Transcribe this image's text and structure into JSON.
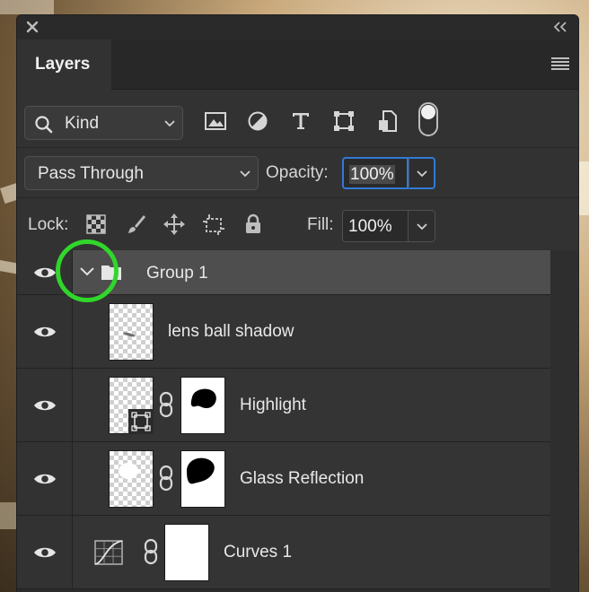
{
  "panel": {
    "tab_label": "Layers"
  },
  "filter": {
    "kind_label": "Kind",
    "icons": [
      "image-filter-icon",
      "adjustment-filter-icon",
      "type-filter-icon",
      "shape-filter-icon",
      "smart-object-filter-icon"
    ]
  },
  "blend": {
    "mode": "Pass Through",
    "opacity_label": "Opacity:",
    "opacity_value": "100%"
  },
  "lock": {
    "label": "Lock:",
    "fill_label": "Fill:",
    "fill_value": "100%"
  },
  "layers": [
    {
      "name": "Group 1",
      "type": "group",
      "expanded": true
    },
    {
      "name": "lens ball shadow",
      "type": "pixel"
    },
    {
      "name": "Highlight",
      "type": "smart-object-with-mask"
    },
    {
      "name": "Glass Reflection",
      "type": "pixel-with-mask"
    },
    {
      "name": "Curves 1",
      "type": "adjustment-curves"
    }
  ],
  "colors": {
    "panel_bg": "#323232",
    "selected_group_bg": "#4e4e4e",
    "focus_blue": "#2f7ad6",
    "annotation_green": "#31d62b"
  }
}
